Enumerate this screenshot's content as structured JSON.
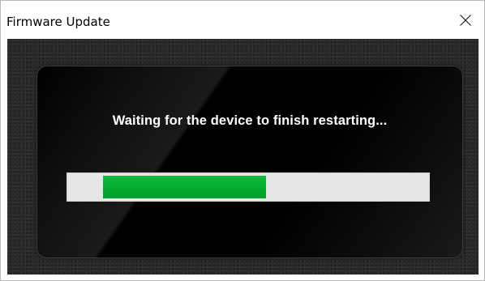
{
  "window": {
    "title": "Firmware Update",
    "close_icon": "close-icon"
  },
  "dialog": {
    "status_text": "Waiting for the device to finish restarting...",
    "progress": {
      "start_fraction": 0.1,
      "end_fraction": 0.55
    }
  },
  "colors": {
    "progress_fill": "#03ac2f",
    "progress_track": "#e6e6e6",
    "panel_background": "#000000",
    "status_text": "#ffffff"
  }
}
